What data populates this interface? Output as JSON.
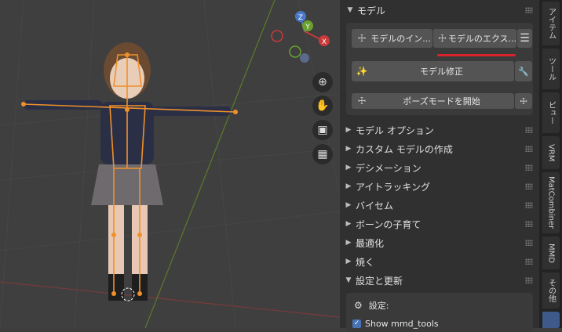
{
  "viewport": {
    "gizmo": {
      "z": "Z",
      "y": "Y",
      "x": "X"
    },
    "tools": [
      {
        "name": "zoom-icon",
        "glyph": "🔍"
      },
      {
        "name": "hand-icon",
        "glyph": "✋"
      },
      {
        "name": "camera-icon",
        "glyph": "🎥"
      },
      {
        "name": "grid-view-icon",
        "glyph": "▦"
      }
    ]
  },
  "panel": {
    "header": "モデル",
    "buttons": {
      "import": "モデルのイン...",
      "export": "モデルのエクス...",
      "fix": "モデル修正",
      "pose_mode": "ポーズモードを開始"
    },
    "sections": [
      "モデル オプション",
      "カスタム モデルの作成",
      "デシメーション",
      "アイトラッキング",
      "バイセム",
      "ボーンの子育て",
      "最適化",
      "焼く",
      "設定と更新"
    ],
    "settings_label": "設定:",
    "show_mmd_tools": "Show mmd_tools"
  },
  "tabs": [
    "アイテム",
    "ツール",
    "ビュー",
    "VRM",
    "MatCombiner",
    "MMD",
    "その他"
  ],
  "colors": {
    "accent_red": "#d8232a",
    "grid_x": "#8a3b3b",
    "grid_y": "#5d7a2a",
    "bone": "#f0902a"
  }
}
